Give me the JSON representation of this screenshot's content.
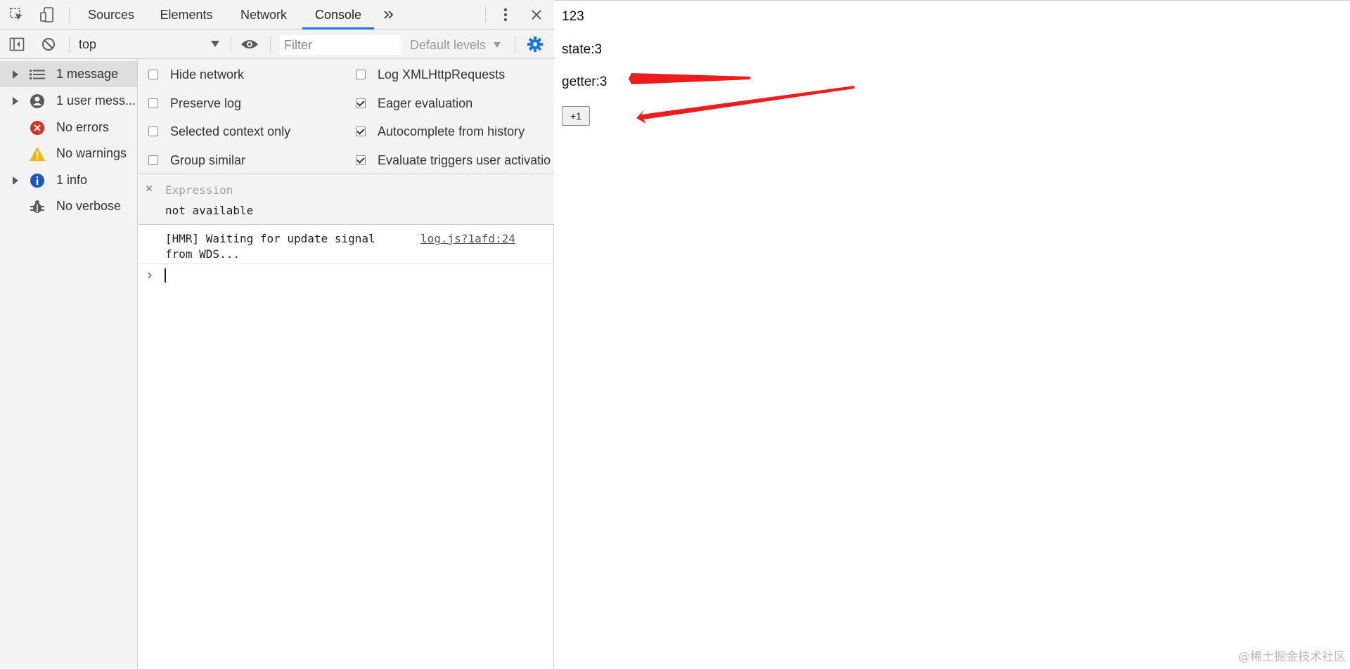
{
  "devtools": {
    "tabs": [
      {
        "label": "Sources"
      },
      {
        "label": "Elements"
      },
      {
        "label": "Network"
      },
      {
        "label": "Console",
        "active": true
      }
    ],
    "more_tabs_icon": "chevrons-right-icon",
    "toolbar": {
      "context": "top",
      "filter_placeholder": "Filter",
      "levels": "Default levels"
    },
    "sidebar": {
      "items": [
        {
          "label": "1 message",
          "icon": "list-icon",
          "expandable": true,
          "selected": true
        },
        {
          "label": "1 user mess...",
          "icon": "user-icon",
          "expandable": true
        },
        {
          "label": "No errors",
          "icon": "error-icon",
          "expandable": false
        },
        {
          "label": "No warnings",
          "icon": "warning-icon",
          "expandable": false
        },
        {
          "label": "1 info",
          "icon": "info-icon",
          "expandable": true
        },
        {
          "label": "No verbose",
          "icon": "bug-icon",
          "expandable": false
        }
      ]
    },
    "settings": {
      "left": [
        {
          "label": "Hide network",
          "checked": false
        },
        {
          "label": "Preserve log",
          "checked": false
        },
        {
          "label": "Selected context only",
          "checked": false
        },
        {
          "label": "Group similar",
          "checked": false
        }
      ],
      "right": [
        {
          "label": "Log XMLHttpRequests",
          "checked": false
        },
        {
          "label": "Eager evaluation",
          "checked": true
        },
        {
          "label": "Autocomplete from history",
          "checked": true
        },
        {
          "label": "Evaluate triggers user activatio",
          "checked": true
        }
      ]
    },
    "expression": {
      "label": "Expression",
      "value": "not available"
    },
    "log": {
      "message": "[HMR] Waiting for update signal from WDS...",
      "source": "log.js?1afd:24"
    },
    "colors": {
      "accent": "#1a73e8",
      "error": "#d93025",
      "warning": "#f2b600",
      "info": "#1a56c4"
    }
  },
  "page": {
    "line1": "123",
    "line2": "state:3",
    "line3": "getter:3",
    "button_label": "+1",
    "watermark": "@稀土掘金技术社区",
    "annotation_color": "#ee1c1c"
  }
}
